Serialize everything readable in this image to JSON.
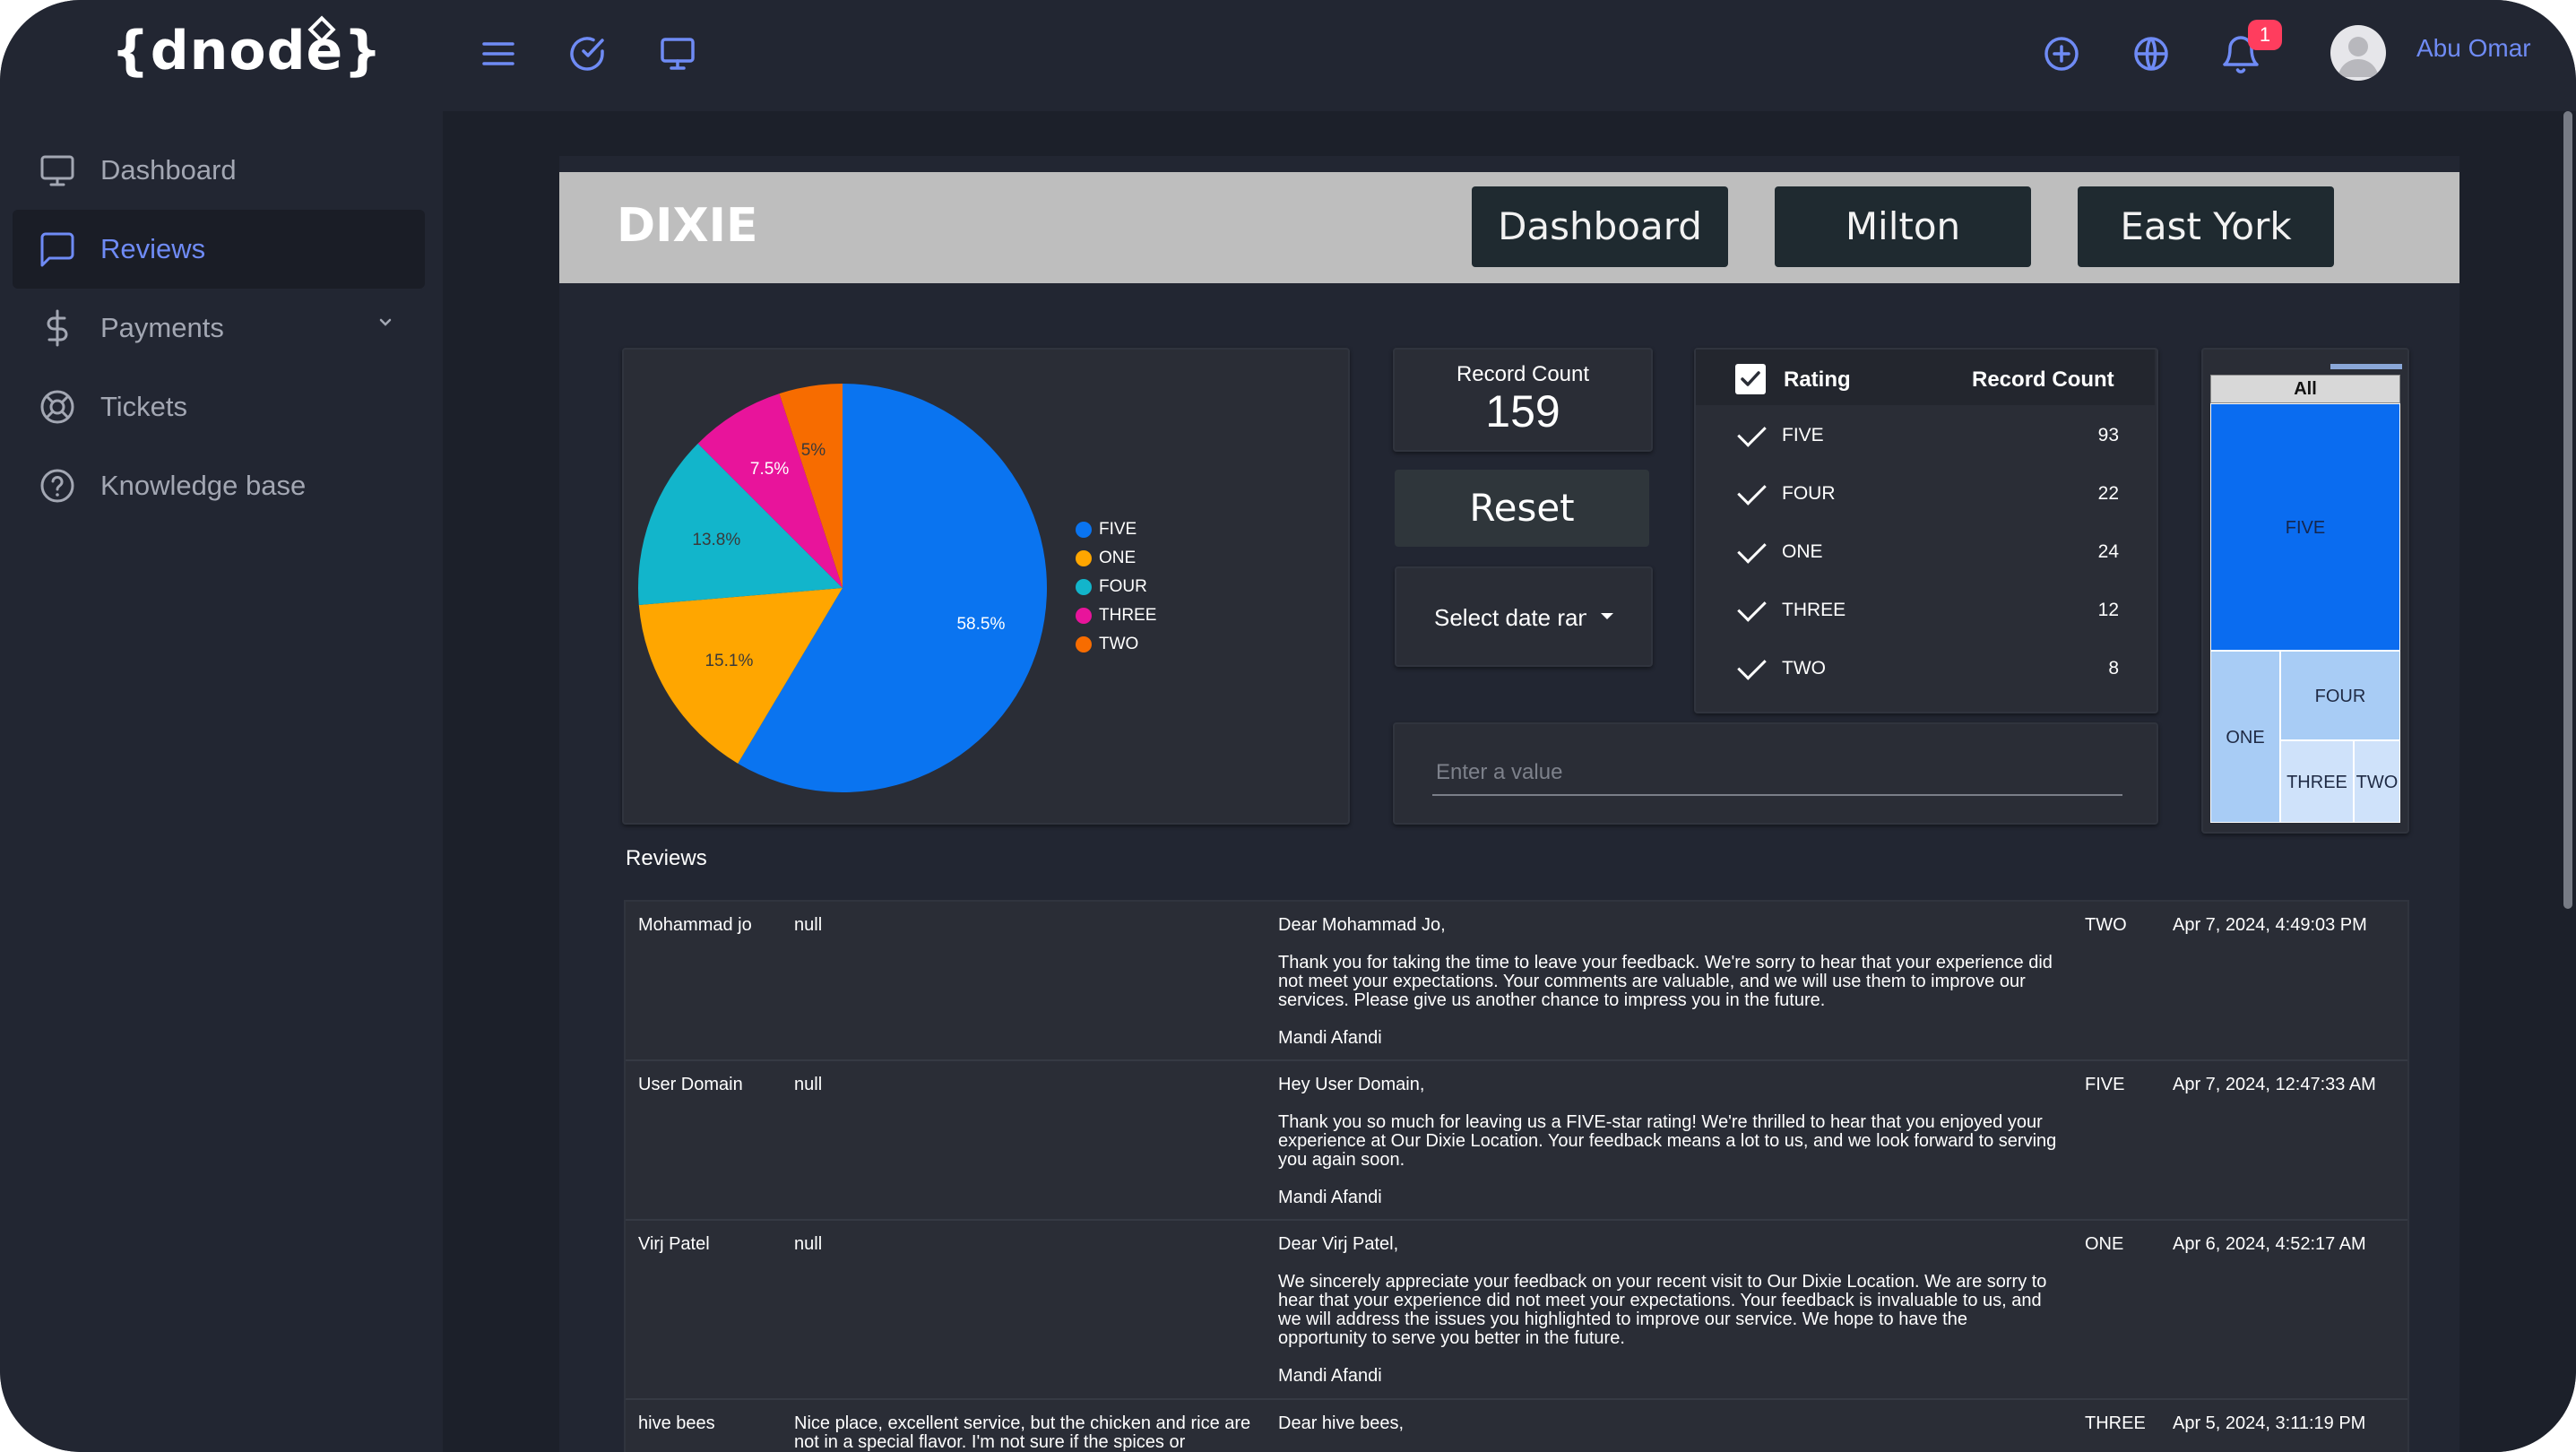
{
  "app": {
    "logo": "{dnode}",
    "user_name": "Abu Omar",
    "notification_count": "1"
  },
  "topbar": {
    "icons": [
      "menu-icon",
      "check-circle-icon",
      "monitor-icon",
      "add-circle-icon",
      "globe-icon",
      "bell-icon"
    ]
  },
  "sidebar": {
    "items": [
      {
        "label": "Dashboard",
        "icon": "monitor-icon",
        "active": false
      },
      {
        "label": "Reviews",
        "icon": "chat-icon",
        "active": true
      },
      {
        "label": "Payments",
        "icon": "dollar-icon",
        "active": false
      },
      {
        "label": "Tickets",
        "icon": "lifebuoy-icon",
        "active": false
      },
      {
        "label": "Knowledge base",
        "icon": "help-circle-icon",
        "active": false
      }
    ]
  },
  "header": {
    "brand": "DIXIE",
    "buttons": [
      "Dashboard",
      "Milton",
      "East York"
    ]
  },
  "record_count": {
    "title": "Record Count",
    "value": "159"
  },
  "reset_label": "Reset",
  "date_select": {
    "label": "Select date range"
  },
  "rating_table": {
    "headers": [
      "Rating",
      "Record Count"
    ],
    "rows": [
      {
        "label": "FIVE",
        "count": "93"
      },
      {
        "label": "FOUR",
        "count": "22"
      },
      {
        "label": "ONE",
        "count": "24"
      },
      {
        "label": "THREE",
        "count": "12"
      },
      {
        "label": "TWO",
        "count": "8"
      }
    ]
  },
  "value_input": {
    "placeholder": "Enter a value"
  },
  "treemap": {
    "header": "All",
    "cells": [
      "FIVE",
      "FOUR",
      "ONE",
      "THREE",
      "TWO"
    ]
  },
  "chart_data": {
    "type": "pie",
    "slices": [
      {
        "name": "FIVE",
        "value": 58.5,
        "label": "58.5%",
        "color": "#0a74f0"
      },
      {
        "name": "ONE",
        "value": 15.1,
        "label": "15.1%",
        "color": "#ffa600"
      },
      {
        "name": "FOUR",
        "value": 13.8,
        "label": "13.8%",
        "color": "#12b5cb"
      },
      {
        "name": "THREE",
        "value": 7.5,
        "label": "7.5%",
        "color": "#e8149b"
      },
      {
        "name": "TWO",
        "value": 5,
        "label": "5%",
        "color": "#f76c00"
      }
    ],
    "legend": [
      "FIVE",
      "ONE",
      "FOUR",
      "THREE",
      "TWO"
    ],
    "legend_position": "right"
  },
  "reviews": {
    "title": "Reviews",
    "rows": [
      {
        "name": "Mohammad jo",
        "comment": "null",
        "reply": [
          "Dear Mohammad Jo,",
          "Thank you for taking the time to leave your feedback. We're sorry to hear that your experience did not meet your expectations. Your comments are valuable, and we will use them to improve our services. Please give us another chance to impress you in the future.",
          "Mandi Afandi"
        ],
        "rating": "TWO",
        "date": "Apr 7, 2024, 4:49:03 PM"
      },
      {
        "name": "User Domain",
        "comment": "null",
        "reply": [
          "Hey User Domain,",
          "Thank you so much for leaving us a FIVE-star rating! We're thrilled to hear that you enjoyed your experience at Our Dixie Location. Your feedback means a lot to us, and we look forward to serving you again soon.",
          "Mandi Afandi"
        ],
        "rating": "FIVE",
        "date": "Apr 7, 2024, 12:47:33 AM"
      },
      {
        "name": "Virj Patel",
        "comment": "null",
        "reply": [
          "Dear Virj Patel,",
          "We sincerely appreciate your feedback on your recent visit to Our Dixie Location. We are sorry to hear that your experience did not meet your expectations. Your feedback is invaluable to us, and we will address the issues you highlighted to improve our service. We hope to have the opportunity to serve you better in the future.",
          "Mandi Afandi"
        ],
        "rating": "ONE",
        "date": "Apr 6, 2024, 4:52:17 AM"
      },
      {
        "name": "hive bees",
        "comment": "Nice place, excellent service, but the chicken and rice are not in a special flavor. I'm not sure if the spices or",
        "reply": [
          "Dear hive bees,",
          "",
          ""
        ],
        "rating": "THREE",
        "date": "Apr 5, 2024, 3:11:19 PM"
      }
    ]
  }
}
